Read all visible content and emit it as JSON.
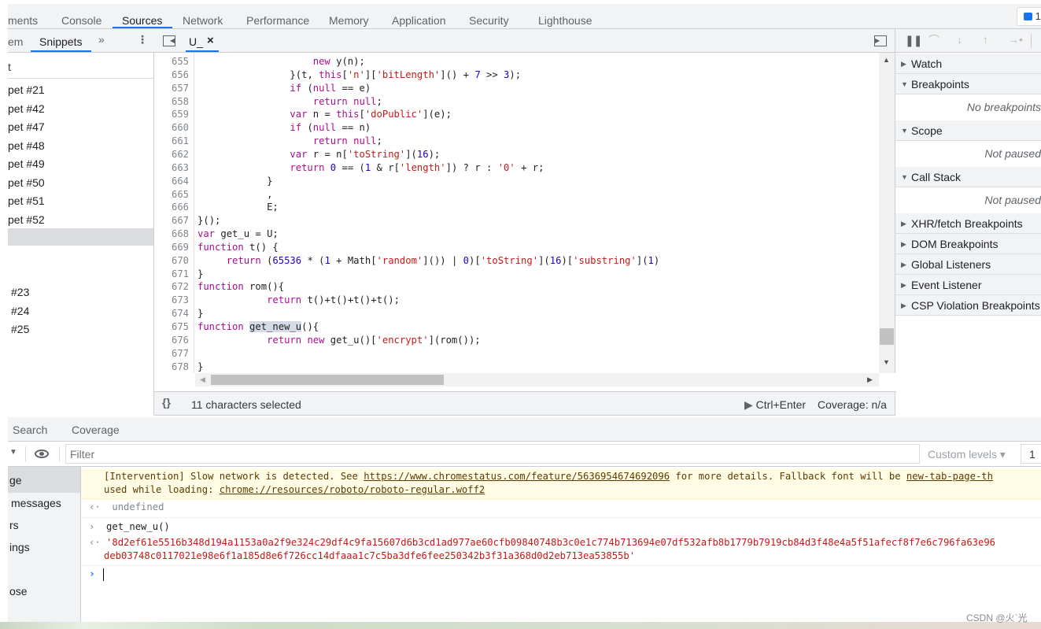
{
  "main_tabs": [
    "ments",
    "Console",
    "Sources",
    "Network",
    "Performance",
    "Memory",
    "Application",
    "Security",
    "Lighthouse"
  ],
  "active_main_tab": "Sources",
  "issues_badge": "1",
  "navigator": {
    "tabs": [
      "em",
      "Snippets"
    ],
    "more": "»",
    "menu": "⋮",
    "filter_text": "t",
    "items": [
      "pet #21",
      "pet #42",
      "pet #47",
      "pet #48",
      "pet #49",
      "pet #50",
      "pet #51",
      "pet #52",
      "",
      "#23",
      "#24",
      "#25"
    ]
  },
  "editor": {
    "file_tab": "U_",
    "close": "×",
    "lines": [
      {
        "n": "655",
        "t": "                    new y(n);"
      },
      {
        "n": "656",
        "t": "                }(t, this['n']['bitLength']() + 7 >> 3);"
      },
      {
        "n": "657",
        "t": "                if (null == e)"
      },
      {
        "n": "658",
        "t": "                    return null;"
      },
      {
        "n": "659",
        "t": "                var n = this['doPublic'](e);"
      },
      {
        "n": "660",
        "t": "                if (null == n)"
      },
      {
        "n": "661",
        "t": "                    return null;"
      },
      {
        "n": "662",
        "t": "                var r = n['toString'](16);"
      },
      {
        "n": "663",
        "t": "                return 0 == (1 & r['length']) ? r : '0' + r;"
      },
      {
        "n": "664",
        "t": "            }"
      },
      {
        "n": "665",
        "t": "            ,"
      },
      {
        "n": "666",
        "t": "            E;"
      },
      {
        "n": "667",
        "t": "}();"
      },
      {
        "n": "668",
        "t": "var get_u = U;"
      },
      {
        "n": "669",
        "t": "function t() {"
      },
      {
        "n": "670",
        "t": "     return (65536 * (1 + Math['random']()) | 0)['toString'](16)['substring'](1)"
      },
      {
        "n": "671",
        "t": "}"
      },
      {
        "n": "672",
        "t": "function rom(){"
      },
      {
        "n": "673",
        "t": "            return t()+t()+t()+t();"
      },
      {
        "n": "674",
        "t": "}"
      },
      {
        "n": "675",
        "t": "function get_new_u(){"
      },
      {
        "n": "676",
        "t": "            return new get_u()['encrypt'](rom());"
      },
      {
        "n": "677",
        "t": ""
      },
      {
        "n": "678",
        "t": "}"
      }
    ],
    "selection": "get_new_u()",
    "status": {
      "format": "{}",
      "selection": "11 characters selected",
      "run": "Ctrl+Enter",
      "coverage": "Coverage: n/a"
    }
  },
  "debugger": {
    "sections": [
      {
        "label": "Watch",
        "open": false
      },
      {
        "label": "Breakpoints",
        "open": true,
        "note": "No breakpoints"
      },
      {
        "label": "Scope",
        "open": true,
        "note": "Not paused"
      },
      {
        "label": "Call Stack",
        "open": true,
        "note": "Not paused"
      },
      {
        "label": "XHR/fetch Breakpoints",
        "open": false
      },
      {
        "label": "DOM Breakpoints",
        "open": false
      },
      {
        "label": "Global Listeners",
        "open": false
      },
      {
        "label": "Event Listener Breakpoints",
        "open": false
      },
      {
        "label": "CSP Violation Breakpoints",
        "open": false
      }
    ]
  },
  "drawer": {
    "tabs": [
      "Search",
      "Coverage"
    ]
  },
  "console": {
    "filter_placeholder": "Filter",
    "levels": "Custom levels ▾",
    "count": "1",
    "sidebar": [
      "ge",
      "messages",
      "rs",
      "ings",
      "ose"
    ],
    "warning": {
      "pre": "[Intervention] Slow network is detected. See ",
      "link": "https://www.chromestatus.com/feature/5636954674692096",
      "mid": " for more details. Fallback font will be ",
      "link2": "new-tab-page-th",
      "line2": "used while loading: ",
      "link3": "chrome://resources/roboto/roboto-regular.woff2"
    },
    "undefined": "undefined",
    "input": "get_new_u()",
    "result1": "'8d2ef61e5516b348d194a1153a0a2f9e324c29df4c9fa15607d6b3cd1ad977ae60cfb09840748b3c0e1c774b713694e07df532afb8b1779b7919cb84d3f48e4a5f51afecf8f7e6c796fa63e96",
    "result2": "deb03748c0117021e98e6f1a185d8e6f726cc14dfaaa1c7c5ba3dfe6fee250342b3f31a368d0d2eb713ea53855b'"
  },
  "watermark": "CSDN @火`光"
}
